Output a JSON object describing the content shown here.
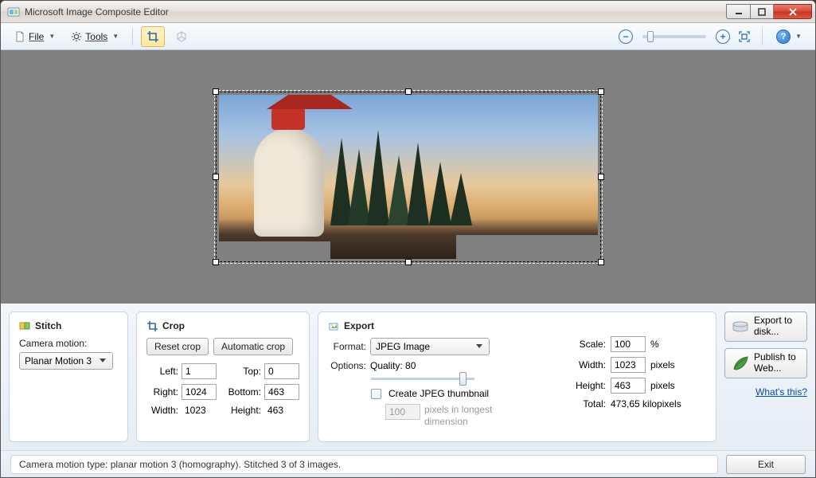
{
  "window": {
    "title": "Microsoft Image Composite Editor"
  },
  "toolbar": {
    "file_label": "File",
    "tools_label": "Tools"
  },
  "panels": {
    "stitch": {
      "title": "Stitch",
      "camera_motion_label": "Camera motion:",
      "camera_motion_value": "Planar Motion 3"
    },
    "crop": {
      "title": "Crop",
      "reset_label": "Reset crop",
      "auto_label": "Automatic crop",
      "left_label": "Left:",
      "left_value": "1",
      "top_label": "Top:",
      "top_value": "0",
      "right_label": "Right:",
      "right_value": "1024",
      "bottom_label": "Bottom:",
      "bottom_value": "463",
      "width_label": "Width:",
      "width_value": "1023",
      "height_label": "Height:",
      "height_value": "463"
    },
    "export": {
      "title": "Export",
      "format_label": "Format:",
      "format_value": "JPEG Image",
      "options_label": "Options:",
      "quality_label": "Quality: 80",
      "thumb_label": "Create JPEG thumbnail",
      "thumb_size": "100",
      "thumb_unit": "pixels in longest dimension",
      "scale_label": "Scale:",
      "scale_value": "100",
      "scale_unit": "%",
      "width_label": "Width:",
      "width_value": "1023",
      "pixels_unit": "pixels",
      "height_label": "Height:",
      "height_value": "463",
      "total_label": "Total:",
      "total_value": "473,65 kilopixels"
    }
  },
  "sidebar": {
    "export_disk": "Export to disk...",
    "publish_web": "Publish to Web...",
    "whats_this": "What's this?"
  },
  "status": {
    "text": "Camera motion type: planar motion 3 (homography). Stitched 3 of 3 images.",
    "exit_label": "Exit"
  }
}
